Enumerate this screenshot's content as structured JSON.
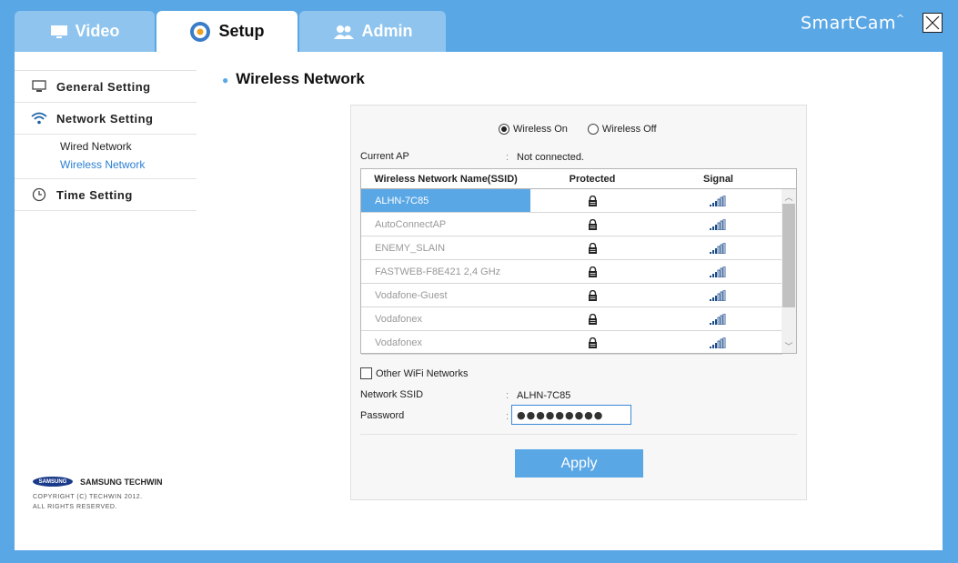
{
  "tabs": [
    {
      "label": "Video",
      "icon": "monitor-icon"
    },
    {
      "label": "Setup",
      "icon": "gear-icon"
    },
    {
      "label": "Admin",
      "icon": "users-icon"
    }
  ],
  "brand_logo": "SmartCam",
  "sidebar": {
    "general": "General Setting",
    "network": "Network Setting",
    "sub": [
      "Wired Network",
      "Wireless Network"
    ],
    "time": "Time Setting"
  },
  "footer": {
    "samsung": "SAMSUNG",
    "company": "SAMSUNG TECHWIN",
    "copyright1": "COPYRIGHT (C) TECHWIN 2012.",
    "copyright2": "ALL RIGHTS RESERVED."
  },
  "page_title": "Wireless Network",
  "wireless": {
    "on_label": "Wireless On",
    "off_label": "Wireless Off",
    "selected": "on",
    "current_ap_label": "Current AP",
    "current_ap_value": "Not connected.",
    "colon": ":"
  },
  "table": {
    "headers": [
      "Wireless Network Name(SSID)",
      "Protected",
      "Signal"
    ],
    "rows": [
      {
        "ssid": "ALHN-7C85",
        "selected": true
      },
      {
        "ssid": "AutoConnectAP"
      },
      {
        "ssid": "ENEMY_SLAIN"
      },
      {
        "ssid": "FASTWEB-F8E421 2,4 GHz"
      },
      {
        "ssid": "Vodafone-Guest"
      },
      {
        "ssid": "Vodafonex"
      },
      {
        "ssid": "Vodafonex"
      }
    ]
  },
  "other_wifi_label": "Other WiFi Networks",
  "network_ssid_label": "Network SSID",
  "network_ssid_value": "ALHN-7C85",
  "password_label": "Password",
  "password_value": "●●●●●●●●●",
  "apply_label": "Apply",
  "colors": {
    "accent": "#5aa7e6",
    "tab_inactive": "#8ec4ee"
  }
}
